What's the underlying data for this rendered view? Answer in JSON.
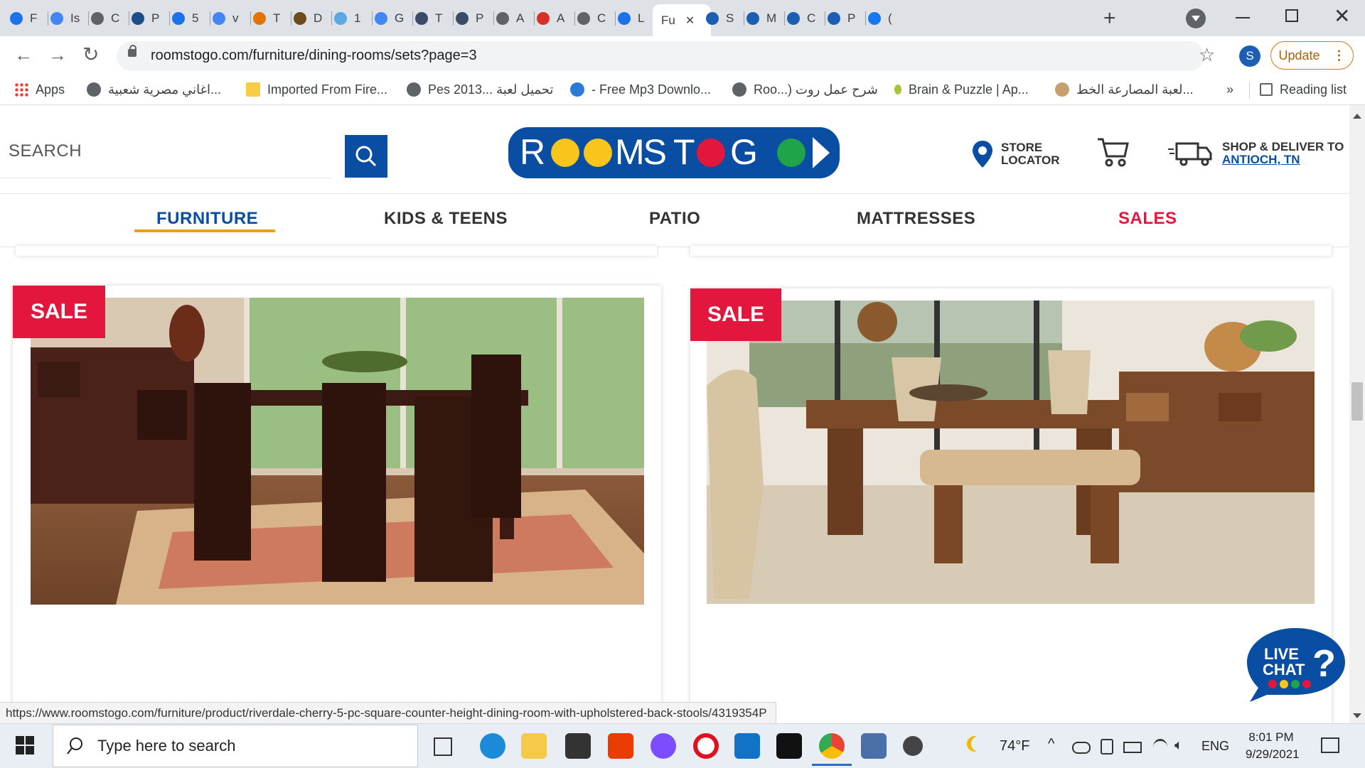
{
  "browser": {
    "tabs": [
      {
        "letter": "F"
      },
      {
        "letter": "Is"
      },
      {
        "letter": "C"
      },
      {
        "letter": "P"
      },
      {
        "letter": "5"
      },
      {
        "letter": "v"
      },
      {
        "letter": "T"
      },
      {
        "letter": "D"
      },
      {
        "letter": "1"
      },
      {
        "letter": "G"
      },
      {
        "letter": "T"
      },
      {
        "letter": "P"
      },
      {
        "letter": "A"
      },
      {
        "letter": "A"
      },
      {
        "letter": "C"
      },
      {
        "letter": "L"
      },
      {
        "letter": "Fu"
      },
      {
        "letter": "S"
      },
      {
        "letter": "M"
      },
      {
        "letter": "C"
      },
      {
        "letter": "P"
      },
      {
        "letter": "("
      }
    ],
    "active_tab_label": "Fu",
    "url": "roomstogo.com/furniture/dining-rooms/sets?page=3",
    "profile_initial": "S",
    "update_label": "Update",
    "bookmarks": [
      {
        "label": "Apps"
      },
      {
        "label": "اغاني مصرية شعبية..."
      },
      {
        "label": "Imported From Fire..."
      },
      {
        "label": "Pes 2013... تحميل لعبة"
      },
      {
        "label": "- Free Mp3 Downlo..."
      },
      {
        "label": "Roo...) شرح عمل روت"
      },
      {
        "label": "Brain & Puzzle | Ap..."
      },
      {
        "label": "لعبة المصارعة الخط..."
      }
    ],
    "more_bookmarks": "»",
    "reading_list": "Reading list"
  },
  "site": {
    "search_placeholder": "SEARCH",
    "logo_text": "ROOMS TO GO",
    "store_locator": [
      "STORE",
      "LOCATOR"
    ],
    "deliver_label": "SHOP & DELIVER TO",
    "deliver_location": "ANTIOCH, TN",
    "nav": [
      "FURNITURE",
      "KIDS & TEENS",
      "PATIO",
      "MATTRESSES",
      "SALES"
    ],
    "products": [
      {
        "badge": "SALE"
      },
      {
        "badge": "SALE"
      }
    ],
    "live_chat": [
      "LIVE",
      "CHAT"
    ]
  },
  "status_url": "https://www.roomstogo.com/furniture/product/riverdale-cherry-5-pc-square-counter-height-dining-room-with-upholstered-back-stools/4319354P",
  "taskbar": {
    "search_placeholder": "Type here to search",
    "weather": "74°F",
    "lang": "ENG",
    "time": "8:01 PM",
    "date": "9/29/2021"
  },
  "colors": {
    "brand_blue": "#0a4ea3",
    "sale_red": "#e3173d",
    "nav_active": "#0a4ea3",
    "nav_underline": "#f39c12"
  }
}
